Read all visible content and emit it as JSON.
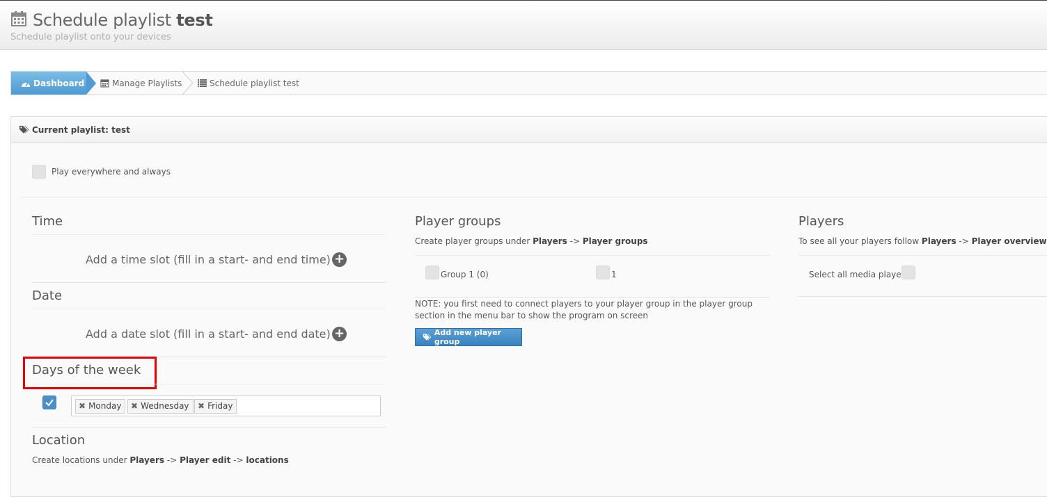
{
  "header": {
    "title_prefix": "Schedule playlist",
    "title_name": "test",
    "subtitle": "Schedule playlist onto your devices"
  },
  "breadcrumb": {
    "items": [
      {
        "label": "Dashboard",
        "icon": "dashboard-icon"
      },
      {
        "label": "Manage Playlists",
        "icon": "calendar-icon"
      },
      {
        "label": "Schedule playlist test",
        "icon": "list-icon"
      }
    ]
  },
  "panel": {
    "title": "Current playlist: test",
    "play_everywhere_label": "Play everywhere and always"
  },
  "time": {
    "title": "Time",
    "add_slot": "Add a time slot (fill in a start- and end time)"
  },
  "date": {
    "title": "Date",
    "add_slot": "Add a date slot (fill in a start- and end date)"
  },
  "days": {
    "title": "Days of the week",
    "selected": [
      "Monday",
      "Wednesday",
      "Friday"
    ]
  },
  "location": {
    "title": "Location",
    "desc_prefix": "Create locations under",
    "desc_path1": "Players",
    "desc_arrow1": "->",
    "desc_path2": "Player edit",
    "desc_arrow2": "->",
    "desc_path3": "locations"
  },
  "player_groups": {
    "title": "Player groups",
    "desc_prefix": "Create player groups under",
    "desc_path1": "Players",
    "desc_arrow": "->",
    "desc_path2": "Player groups",
    "groups": [
      "Group 1 (0)",
      "1"
    ],
    "note": "NOTE: you first need to connect players to your player group in the player group section in the menu bar to show the program on screen",
    "add_button": "Add new player group"
  },
  "players": {
    "title": "Players",
    "desc_prefix": "To see all your players follow",
    "desc_path1": "Players",
    "desc_arrow": "->",
    "desc_path2": "Player overview",
    "select_all": "Select all media players"
  }
}
